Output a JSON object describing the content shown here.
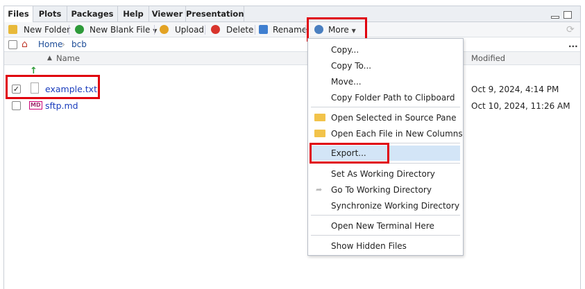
{
  "tabs": [
    {
      "label": "Files",
      "active": true
    },
    {
      "label": "Plots"
    },
    {
      "label": "Packages"
    },
    {
      "label": "Help"
    },
    {
      "label": "Viewer"
    },
    {
      "label": "Presentation"
    }
  ],
  "toolbar": {
    "new_folder": "New Folder",
    "new_blank_file": "New Blank File",
    "upload": "Upload",
    "delete": "Delete",
    "rename": "Rename",
    "more": "More"
  },
  "breadcrumb": {
    "home": "Home",
    "folder": "bcb",
    "more": "..."
  },
  "table": {
    "col_name": "Name",
    "col_modified": "Modified"
  },
  "files": [
    {
      "name": "example.txt",
      "modified": "Oct 9, 2024, 4:14 PM",
      "checked": true,
      "type": "txt"
    },
    {
      "name": "sftp.md",
      "modified": "Oct 10, 2024, 11:26 AM",
      "checked": false,
      "type": "md",
      "badge": "MD"
    }
  ],
  "menu": {
    "items": [
      "Copy...",
      "Copy To...",
      "Move...",
      "Copy Folder Path to Clipboard",
      "Open Selected in Source Pane",
      "Open Each File in New Columns",
      "Export...",
      "Set As Working Directory",
      "Go To Working Directory",
      "Synchronize Working Directory",
      "Open New Terminal Here",
      "Show Hidden Files"
    ]
  },
  "colors": {
    "accent_red": "#e0000e",
    "link_blue": "#1a3dbd",
    "menu_selected": "#d3e5f7"
  }
}
